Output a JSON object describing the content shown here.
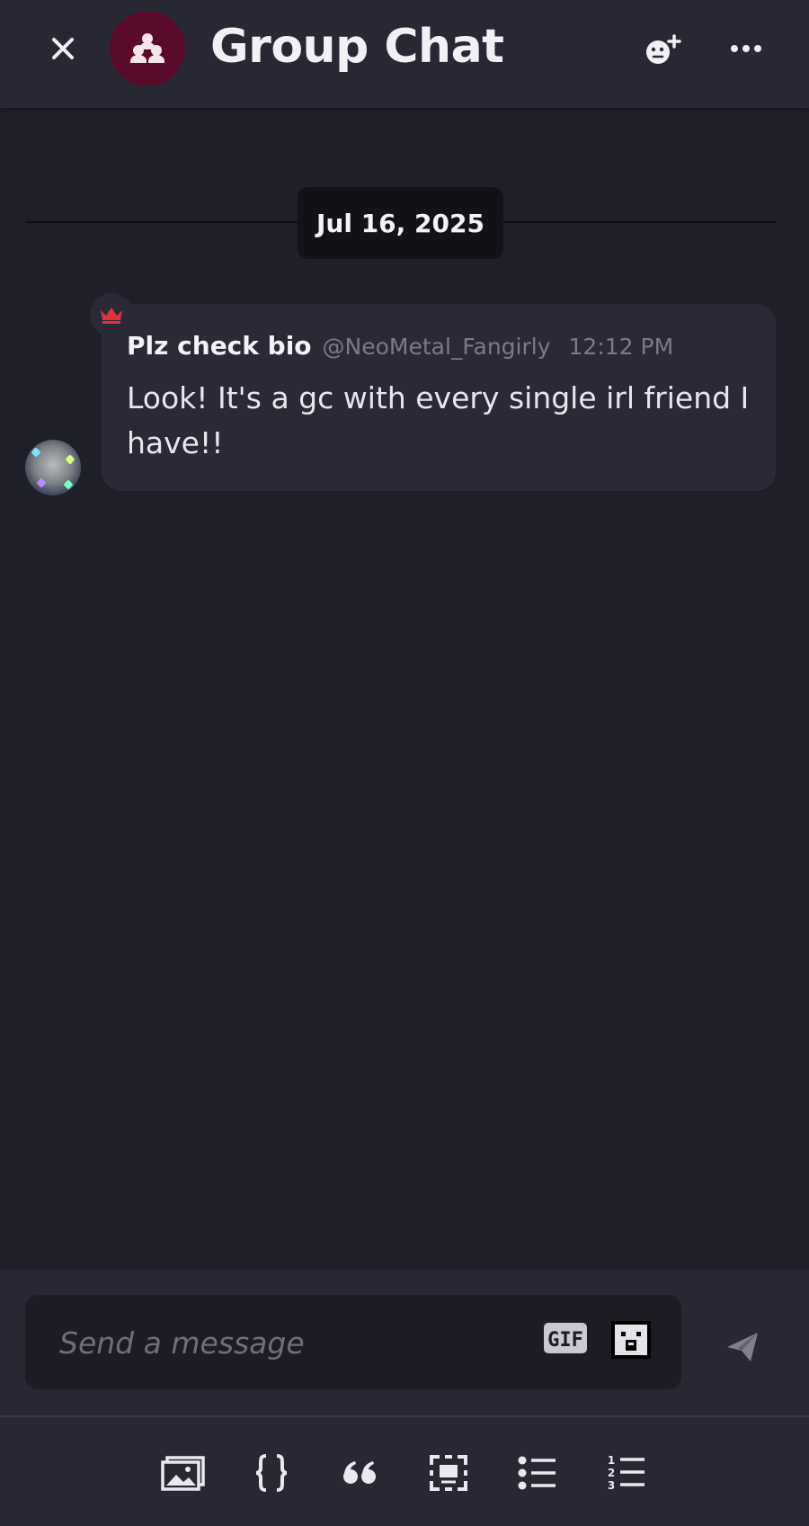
{
  "header": {
    "title": "Group Chat",
    "close_icon": "close-icon",
    "group_icon": "group-icon",
    "add_friend_icon": "add-friend-icon",
    "more_icon": "more-icon",
    "avatar_color": "#5a0a2a"
  },
  "date_separator": "Jul 16, 2025",
  "message": {
    "author": "Plz check bio",
    "handle": "@NeoMetal_Fangirly",
    "time": "12:12 PM",
    "text": "Look! It's a gc with every single irl friend I have!!",
    "badge_icon": "crown-icon",
    "badge_color": "#e0323c"
  },
  "composer": {
    "placeholder": "Send a message",
    "value": "",
    "gif_label": "GIF",
    "sticker_icon": "sticker-icon",
    "send_icon": "send-icon"
  },
  "toolbar": {
    "items": [
      "image-icon",
      "code-block-icon",
      "quote-icon",
      "spoiler-icon",
      "bullet-list-icon",
      "numbered-list-icon"
    ]
  }
}
